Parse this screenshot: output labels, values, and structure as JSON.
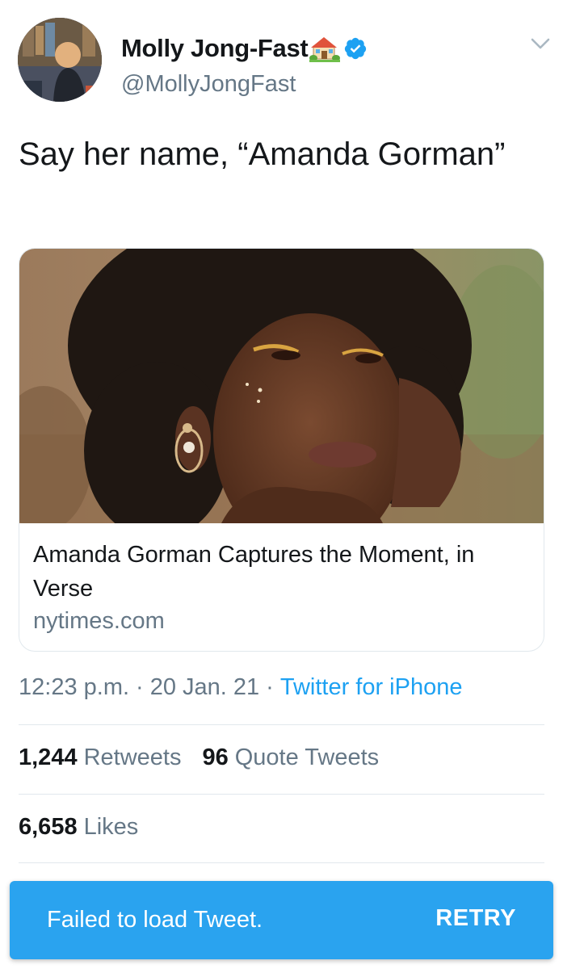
{
  "tweet": {
    "author": {
      "display_name": "Molly Jong-Fast",
      "name_emoji_icon": "house-with-garden-icon",
      "verified_icon": "verified-badge-icon",
      "handle": "@MollyJongFast"
    },
    "text": "Say her name, “Amanda Gorman”",
    "card": {
      "title": "Amanda Gorman Captures the Moment, in Verse",
      "domain": "nytimes.com"
    },
    "meta": {
      "time": "12:23 p.m.",
      "separator": "·",
      "date": "20 Jan. 21",
      "source": "Twitter for iPhone"
    },
    "stats": {
      "retweets_count": "1,244",
      "retweets_label": "Retweets",
      "quotes_count": "96",
      "quotes_label": "Quote Tweets",
      "likes_count": "6,658",
      "likes_label": "Likes"
    }
  },
  "toast": {
    "message": "Failed to load Tweet.",
    "action": "RETRY"
  },
  "colors": {
    "primary_text": "#14171a",
    "secondary_text": "#657786",
    "link": "#1da1f2",
    "verified": "#1da1f2",
    "toast_bg": "#2aa3ef",
    "divider": "#e1e8ed"
  }
}
